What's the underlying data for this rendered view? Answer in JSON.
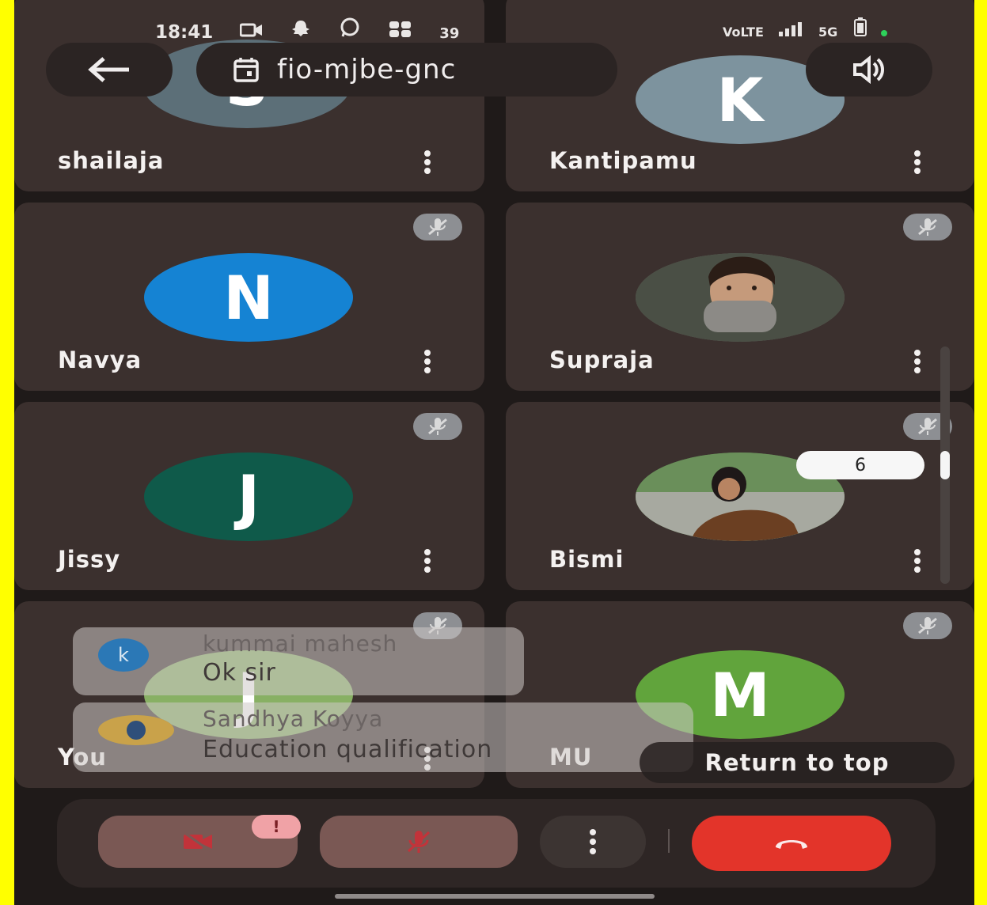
{
  "status_bar": {
    "time": "18:41",
    "notification_count": "39",
    "network_label": "VoLTE",
    "signal_label": "5G"
  },
  "header": {
    "meeting_code": "fio-mjbe-gnc"
  },
  "participants": [
    {
      "name": "shailaja",
      "initial": "S",
      "avatar_color": "#5c6f78",
      "muted": false
    },
    {
      "name": "Kantipamu",
      "initial": "K",
      "avatar_color": "#7d939e",
      "muted": false
    },
    {
      "name": "Navya",
      "initial": "N",
      "avatar_color": "#1583d3",
      "muted": true
    },
    {
      "name": "Supraja",
      "initial": "",
      "avatar_color": "#6b6f66",
      "muted": true
    },
    {
      "name": "Jissy",
      "initial": "J",
      "avatar_color": "#0f5a4a",
      "muted": true
    },
    {
      "name": "Bismi",
      "initial": "",
      "avatar_color": "#4d7a4b",
      "muted": true
    },
    {
      "name": "You",
      "initial": "J",
      "avatar_color": "#88b064",
      "muted": true
    },
    {
      "name": "MU",
      "initial": "M",
      "avatar_color": "#61a43c",
      "muted": true
    }
  ],
  "reaction_badge": "6",
  "chat_messages": [
    {
      "sender": "kummai mahesh",
      "sender_initial": "k",
      "text": "Ok sir"
    },
    {
      "sender": "Sandhya Koyya",
      "sender_initial": "",
      "text": "Education qualification"
    }
  ],
  "return_to_top_label": "Return to top",
  "colors": {
    "background": "#1f1a19",
    "tile": "#3b302e",
    "end_call": "#e3342a",
    "alert_badge": "#f0a2a6",
    "frame": "#ffff00"
  }
}
